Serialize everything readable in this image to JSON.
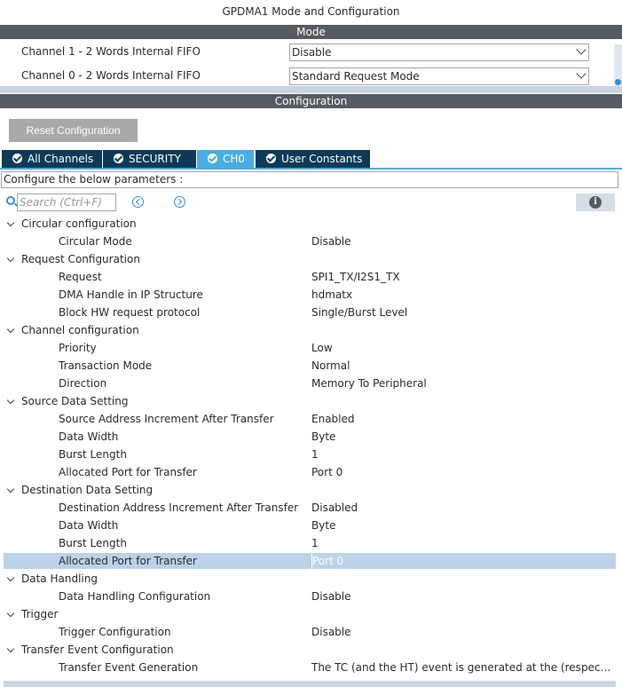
{
  "window": {
    "title": "GPDMA1 Mode and Configuration"
  },
  "mode": {
    "header": "Mode",
    "rows": [
      {
        "label": "Channel 1  - 2 Words Internal FIFO",
        "value": "Disable"
      },
      {
        "label": "Channel 0  - 2 Words Internal FIFO",
        "value": "Standard Request Mode"
      }
    ]
  },
  "config": {
    "header": "Configuration",
    "reset_label": "Reset Configuration",
    "tabs": [
      {
        "label": "All Channels"
      },
      {
        "label": "SECURITY"
      },
      {
        "label": "CH0"
      },
      {
        "label": "User Constants"
      }
    ],
    "configure_text": "Configure the below parameters :",
    "search_placeholder": "Search (Ctrl+F)",
    "info_icon": "info-icon",
    "groups": [
      {
        "label": "Circular configuration",
        "params": [
          {
            "label": "Circular Mode",
            "value": "Disable"
          }
        ]
      },
      {
        "label": "Request Configuration",
        "params": [
          {
            "label": "Request",
            "value": "SPI1_TX/I2S1_TX"
          },
          {
            "label": "DMA Handle in IP Structure",
            "value": "hdmatx"
          },
          {
            "label": "Block HW request protocol",
            "value": "Single/Burst Level"
          }
        ]
      },
      {
        "label": "Channel configuration",
        "params": [
          {
            "label": "Priority",
            "value": "Low"
          },
          {
            "label": "Transaction Mode",
            "value": "Normal"
          },
          {
            "label": "Direction",
            "value": "Memory To Peripheral"
          }
        ]
      },
      {
        "label": "Source Data Setting",
        "params": [
          {
            "label": "Source Address Increment After Transfer",
            "value": "Enabled"
          },
          {
            "label": "Data Width",
            "value": "Byte"
          },
          {
            "label": "Burst Length",
            "value": "1"
          },
          {
            "label": "Allocated Port for Transfer",
            "value": "Port 0"
          }
        ]
      },
      {
        "label": "Destination Data Setting",
        "params": [
          {
            "label": "Destination Address Increment After Transfer",
            "value": "Disabled"
          },
          {
            "label": "Data Width",
            "value": "Byte"
          },
          {
            "label": "Burst Length",
            "value": "1"
          },
          {
            "label": "Allocated Port for Transfer",
            "value": "Port 0",
            "selected": true
          }
        ]
      },
      {
        "label": "Data Handling",
        "params": [
          {
            "label": "Data Handling Configuration",
            "value": "Disable"
          }
        ]
      },
      {
        "label": "Trigger",
        "params": [
          {
            "label": "Trigger Configuration",
            "value": "Disable"
          }
        ]
      },
      {
        "label": "Transfer Event Configuration",
        "params": [
          {
            "label": "Transfer Event Generation",
            "value": "The TC (and the HT) event is generated at the (respective half) end of each block"
          }
        ]
      }
    ]
  },
  "colors": {
    "header_bar": "#545b61",
    "tab_dark": "#0c3a57",
    "tab_active": "#48aee2",
    "selection": "#bcd2e8"
  }
}
